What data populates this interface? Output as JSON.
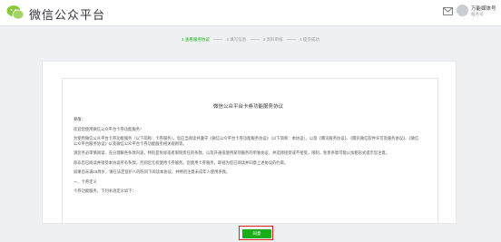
{
  "header": {
    "brand": "微信公众平台",
    "user_name": "万能媒体号",
    "user_sub": "服务号"
  },
  "steps": [
    {
      "label": "1 查看服务协议",
      "active": true
    },
    {
      "label": "2 填写信息",
      "active": false
    },
    {
      "label": "3 资料审核",
      "active": false
    },
    {
      "label": "4 提交成功",
      "active": false
    }
  ],
  "agreement": {
    "title": "微信公众平台卡券功能服务协议",
    "paragraphs": [
      "尊敬：",
      "欢迎您使用微信公众平台卡券功能服务！",
      "为使用微信公众平台卡券功能服务（以下简称：卡券服务），您应当阅读并遵守《微信公众平台卡券功能服务协议》（以下简称：本协议），以及《腾讯服务协议》、《腾讯微信软件许可及服务协议》、《微信公众平台服务协议》以及微信公众平台卡券功能服务相关规则等。",
      "请您务必审慎阅读、充分理解各条款内容，特别是免除或者限制责任的条款，以及开通或使用某项服务的单独协议，并选择接受或不接受。限制、免责条款可能以加粗形式提示您注意。",
      "除非您已阅读并接受本协议所有条款，否则您无权使用卡券服务。您使用卡券服务，即视为您已阅读并同意上述协议的约束。",
      "如果您未满18周岁，请在法定监护人的陪同下阅读本协议，并特别注意未成年人使用条款。",
      "一、卡券定义",
      "卡券功能服务，下列术语定义如下："
    ]
  },
  "buttons": {
    "agree": "同意"
  },
  "colors": {
    "accent": "#1aad19",
    "highlight": "#e02020"
  }
}
